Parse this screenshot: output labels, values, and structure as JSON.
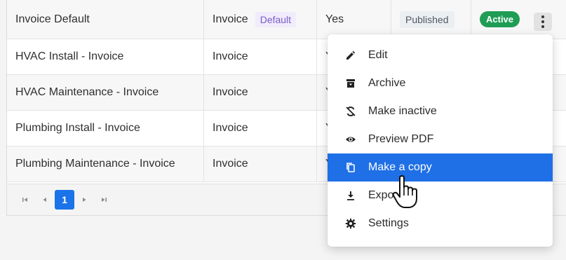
{
  "table": {
    "rows": [
      {
        "name": "Invoice Default",
        "type": "Invoice",
        "type_tag": "Default",
        "col3": "Yes",
        "status": "Published",
        "state": "Active"
      },
      {
        "name": "HVAC Install - Invoice",
        "type": "Invoice",
        "col3": "Y"
      },
      {
        "name": "HVAC Maintenance - Invoice",
        "type": "Invoice",
        "col3": "Y"
      },
      {
        "name": "Plumbing Install - Invoice",
        "type": "Invoice",
        "col3": "Y"
      },
      {
        "name": "Plumbing Maintenance - Invoice",
        "type": "Invoice",
        "col3": "Y"
      }
    ]
  },
  "pagination": {
    "current_page": "1",
    "first_icon": "first-page-icon",
    "prev_icon": "prev-page-icon",
    "next_icon": "next-page-icon",
    "last_icon": "last-page-icon"
  },
  "menu": {
    "items": [
      {
        "label": "Edit",
        "icon": "pencil-icon"
      },
      {
        "label": "Archive",
        "icon": "archive-icon"
      },
      {
        "label": "Make inactive",
        "icon": "sync-disabled-icon"
      },
      {
        "label": "Preview PDF",
        "icon": "eye-icon"
      },
      {
        "label": "Make a copy",
        "icon": "copy-icon"
      },
      {
        "label": "Expo",
        "icon": "download-icon"
      },
      {
        "label": "Settings",
        "icon": "gear-icon"
      }
    ],
    "highlighted_index": 4
  },
  "colors": {
    "accent": "#1f6fe6",
    "active_badge": "#1f9d55",
    "default_tag": "#7b5cc8"
  }
}
